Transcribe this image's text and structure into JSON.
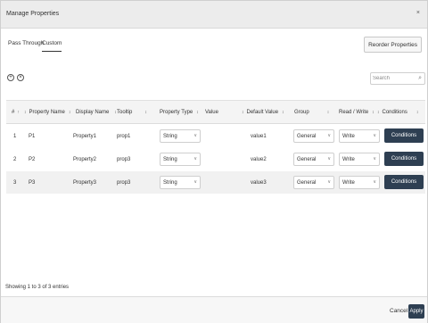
{
  "dialog": {
    "title": "Manage Properties",
    "close": "×"
  },
  "tabs": [
    {
      "label": "Pass Through",
      "active": false
    },
    {
      "label": "Custom",
      "active": true
    }
  ],
  "toolbar": {
    "reorder_label": "Reorder Properties",
    "add_icon": "plus-circle-icon",
    "remove_icon": "x-circle-icon",
    "add_glyph": "+",
    "remove_glyph": "×"
  },
  "search": {
    "placeholder": "Search",
    "icon": "search-icon"
  },
  "table": {
    "headers": [
      "#",
      "Property Name",
      "Display Name",
      "Tooltip",
      "Property Type",
      "Value",
      "Default Value",
      "Group",
      "Read / Write",
      "Conditions"
    ],
    "rows": [
      {
        "num": "1",
        "name": "P1",
        "display": "Property1",
        "tooltip": "prop1",
        "type": "String",
        "value": "",
        "default": "value1",
        "group": "General",
        "rw": "Write",
        "cond": "Conditions"
      },
      {
        "num": "2",
        "name": "P2",
        "display": "Property2",
        "tooltip": "prop3",
        "type": "String",
        "value": "",
        "default": "value2",
        "group": "General",
        "rw": "Write",
        "cond": "Conditions"
      },
      {
        "num": "3",
        "name": "P3",
        "display": "Property3",
        "tooltip": "prop3",
        "type": "String",
        "value": "",
        "default": "value3",
        "group": "General",
        "rw": "Write",
        "cond": "Conditions"
      }
    ]
  },
  "footer": {
    "info": "Showing 1 to 3 of 3 entries",
    "cancel": "Cancel",
    "apply": "Apply"
  }
}
